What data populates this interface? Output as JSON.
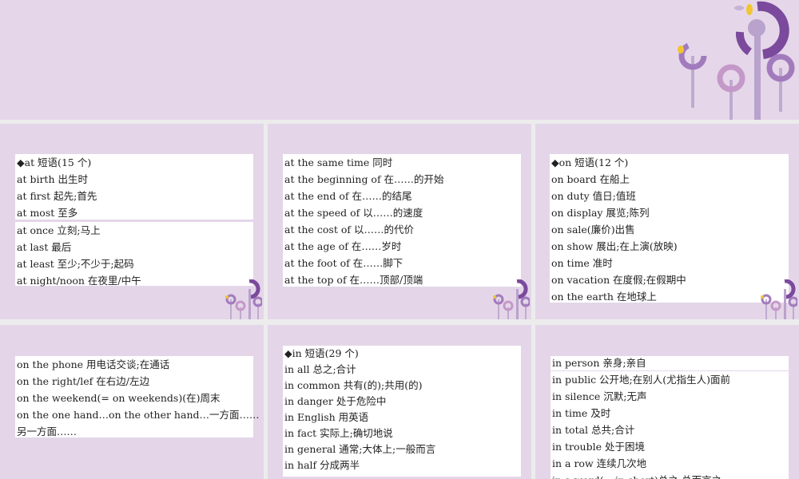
{
  "slides": [
    {
      "box1": [
        "◆at 短语(15 个)",
        "at birth 出生时",
        "at first 起先;首先",
        "at most 至多"
      ],
      "box2": [
        "at once 立刻;马上",
        "at last 最后",
        "at least 至少;不少于;起码",
        "at night/noon 在夜里/中午"
      ]
    },
    {
      "box1": [
        "at the same time 同时",
        "at the beginning of 在……的开始",
        "at the end of 在……的结尾",
        "at the speed of 以……的速度",
        "at the cost of 以……的代价",
        "at the age of 在……岁时",
        "at the foot of 在……脚下",
        "at the top of 在……顶部/顶端"
      ]
    },
    {
      "box1": [
        "◆on 短语(12 个)",
        "on board 在船上",
        "on duty 值日;值班",
        "on display 展览;陈列",
        "on sale(廉价)出售",
        "on show 展出;在上演(放映)",
        "on time 准时",
        "on vacation 在度假;在假期中",
        "on the earth 在地球上"
      ]
    },
    {
      "box1": [
        "on the phone 用电话交谈;在通话",
        "on the right/lef 在右边/左边",
        "on the weekend(= on weekends)(在)周末",
        "on the one hand…on the other hand…一方面……",
        "另一方面……"
      ]
    },
    {
      "box1": [
        "◆in 短语(29 个)",
        "in all 总之;合计",
        "in common 共有(的);共用(的)",
        "in danger 处于危险中",
        "in English 用英语",
        "in fact 实际上;确切地说",
        "in general 通常;大体上;一般而言",
        "in half 分成两半"
      ]
    },
    {
      "box1": [
        "in person 亲身;亲自"
      ],
      "box2": [
        "in public 公开地;在别人(尤指生人)面前",
        "in silence 沉默;无声",
        "in time 及时",
        "in total 总共;合计",
        "in trouble 处于困境",
        "in a row 连续几次地",
        "in a word(= in short)总之;总而言之"
      ]
    }
  ],
  "colors": {
    "banner": "#e5d7e9",
    "accent": "#7b4a9c",
    "yellow": "#f2c530"
  }
}
